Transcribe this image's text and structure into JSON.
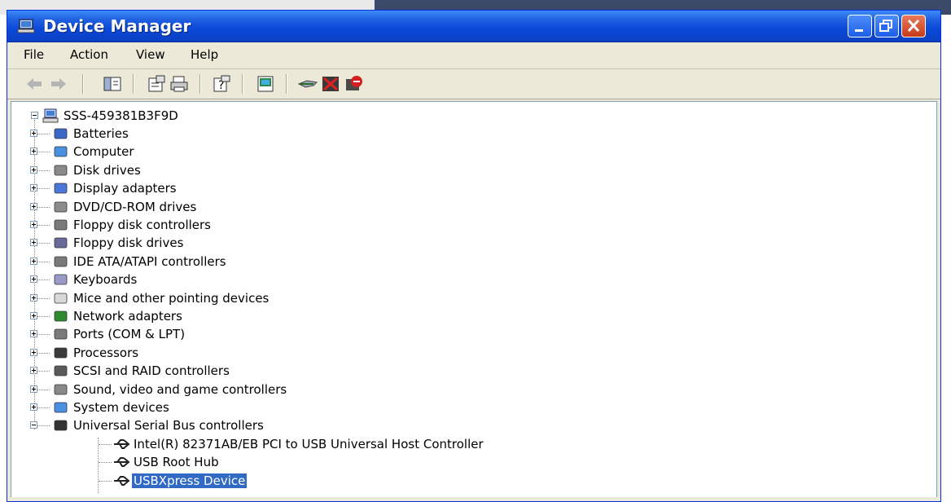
{
  "window": {
    "title": "Device Manager"
  },
  "menu": {
    "items": [
      "File",
      "Action",
      "View",
      "Help"
    ]
  },
  "toolbar": {
    "icons": [
      "back-icon",
      "forward-icon",
      "show-hide-console-tree-icon",
      "properties-icon",
      "print-icon",
      "help-icon",
      "scan-hardware-icon",
      "update-driver-icon",
      "disable-device-icon",
      "uninstall-device-icon"
    ]
  },
  "tree": {
    "root": "SSS-459381B3F9D",
    "categories": [
      "Batteries",
      "Computer",
      "Disk drives",
      "Display adapters",
      "DVD/CD-ROM drives",
      "Floppy disk controllers",
      "Floppy disk drives",
      "IDE ATA/ATAPI controllers",
      "Keyboards",
      "Mice and other pointing devices",
      "Network adapters",
      "Ports (COM & LPT)",
      "Processors",
      "SCSI and RAID controllers",
      "Sound, video and game controllers",
      "System devices",
      "Universal Serial Bus controllers"
    ],
    "usb_children": [
      "Intel(R) 82371AB/EB PCI to USB Universal Host Controller",
      "USB Root Hub",
      "USBXpress Device"
    ],
    "selected": "USBXpress Device"
  },
  "colors": {
    "titlebar": "#0a49d8",
    "selection": "#316ac5",
    "window_face": "#ece9d8"
  }
}
